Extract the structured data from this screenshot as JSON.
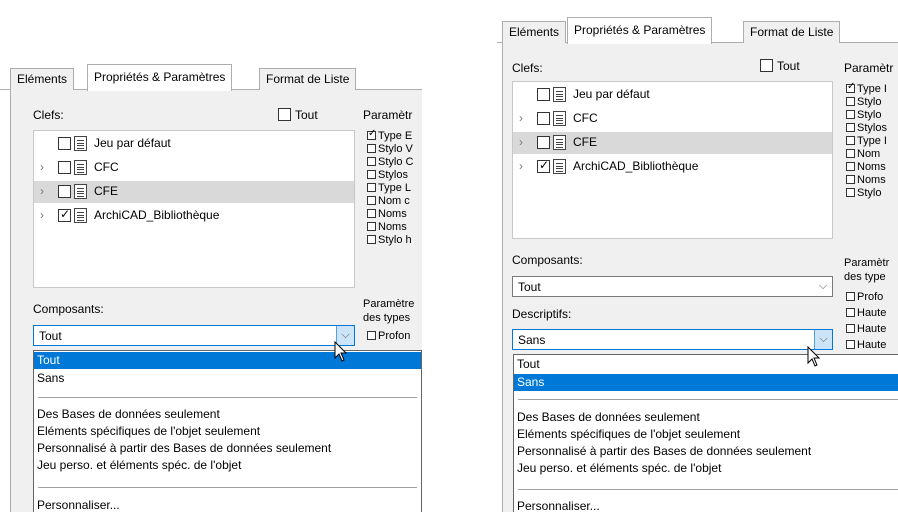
{
  "left": {
    "tabs": [
      "Eléments",
      "Propriétés & Paramètres",
      "Format de Liste"
    ],
    "keys_label": "Clefs:",
    "tout_label": "Tout",
    "params_label": "Paramètr",
    "tree": [
      {
        "label": "Jeu par défaut",
        "checked": false
      },
      {
        "label": "CFC",
        "checked": false
      },
      {
        "label": "CFE",
        "checked": false
      },
      {
        "label": "ArchiCAD_Bibliothèque",
        "checked": true
      }
    ],
    "params": [
      {
        "label": "Type E",
        "checked": true
      },
      {
        "label": "Stylo V",
        "checked": false
      },
      {
        "label": "Stylo C",
        "checked": false
      },
      {
        "label": "Stylos",
        "checked": false
      },
      {
        "label": "Type L",
        "checked": false
      },
      {
        "label": "Nom c",
        "checked": false
      },
      {
        "label": "Noms",
        "checked": false
      },
      {
        "label": "Noms",
        "checked": false
      },
      {
        "label": "Stylo h",
        "checked": false
      }
    ],
    "composants_label": "Composants:",
    "params_types_line1": "Paramètre",
    "params_types_line2": "des types",
    "types_item": "Profon",
    "combo_value": "Tout",
    "dropdown": [
      "Tout",
      "Sans",
      "Des Bases de données seulement",
      "Eléments spécifiques de l'objet seulement",
      "Personnalisé à partir des Bases de données seulement",
      "Jeu perso. et éléments spéc. de l'objet",
      "Personnaliser..."
    ]
  },
  "right": {
    "tabs": [
      "Eléments",
      "Propriétés & Paramètres",
      "Format de Liste"
    ],
    "keys_label": "Clefs:",
    "tout_label": "Tout",
    "params_label": "Paramètr",
    "tree": [
      {
        "label": "Jeu par défaut",
        "checked": false
      },
      {
        "label": "CFC",
        "checked": false
      },
      {
        "label": "CFE",
        "checked": false
      },
      {
        "label": "ArchiCAD_Bibliothèque",
        "checked": true
      }
    ],
    "params": [
      {
        "label": "Type I",
        "checked": true
      },
      {
        "label": "Stylo",
        "checked": false
      },
      {
        "label": "Stylo",
        "checked": false
      },
      {
        "label": "Stylos",
        "checked": false
      },
      {
        "label": "Type I",
        "checked": false
      },
      {
        "label": "Nom",
        "checked": false
      },
      {
        "label": "Noms",
        "checked": false
      },
      {
        "label": "Noms",
        "checked": false
      },
      {
        "label": "Stylo",
        "checked": false
      }
    ],
    "composants_label": "Composants:",
    "composants_value": "Tout",
    "params_types_line1": "Paramètr",
    "params_types_line2": "des type",
    "types_items": [
      "Profo",
      "Haute",
      "Haute",
      "Haute"
    ],
    "descriptifs_label": "Descriptifs:",
    "combo_value": "Sans",
    "dropdown": [
      "Tout",
      "Sans",
      "Des Bases de données seulement",
      "Eléments spécifiques de l'objet seulement",
      "Personnalisé à partir des Bases de données seulement",
      "Jeu perso. et éléments spéc. de l'objet",
      "Personnaliser..."
    ]
  }
}
